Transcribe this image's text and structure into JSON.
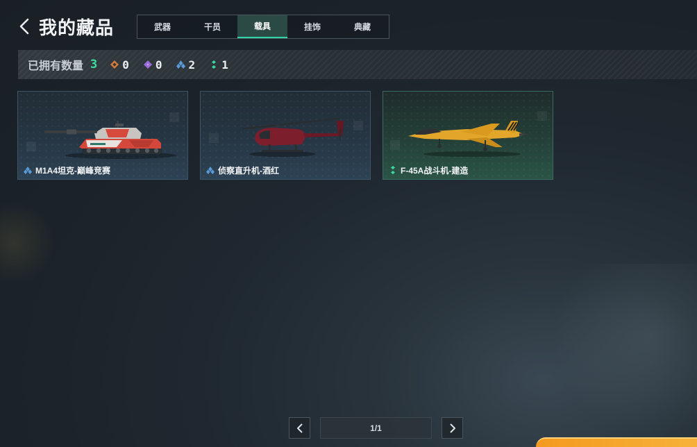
{
  "header": {
    "title": "我的藏品"
  },
  "tabs": [
    {
      "label": "武器",
      "active": false
    },
    {
      "label": "干员",
      "active": false
    },
    {
      "label": "载具",
      "active": true
    },
    {
      "label": "挂饰",
      "active": false
    },
    {
      "label": "典藏",
      "active": false
    }
  ],
  "stats": {
    "label": "已拥有数量",
    "total": "3",
    "rarities": [
      {
        "icon": "orange-rarity-icon",
        "color": "#d27a3a",
        "count": "0"
      },
      {
        "icon": "purple-rarity-icon",
        "color": "#9a6ad8",
        "count": "0"
      },
      {
        "icon": "blue-rarity-icon",
        "color": "#5a9ad8",
        "count": "2"
      },
      {
        "icon": "green-rarity-icon",
        "color": "#3bd8a0",
        "count": "1"
      }
    ]
  },
  "items": [
    {
      "name": "M1A4坦克-巅峰竞赛",
      "rarity": "blue",
      "icon": "tank-icon"
    },
    {
      "name": "侦察直升机-酒红",
      "rarity": "blue",
      "icon": "helicopter-icon"
    },
    {
      "name": "F-45A战斗机-建造",
      "rarity": "green",
      "icon": "fighter-jet-icon"
    }
  ],
  "pagination": {
    "text": "1/1"
  },
  "colors": {
    "accent": "#2fd7a6",
    "total": "#3be0a0",
    "corner": "#f39a1e"
  }
}
